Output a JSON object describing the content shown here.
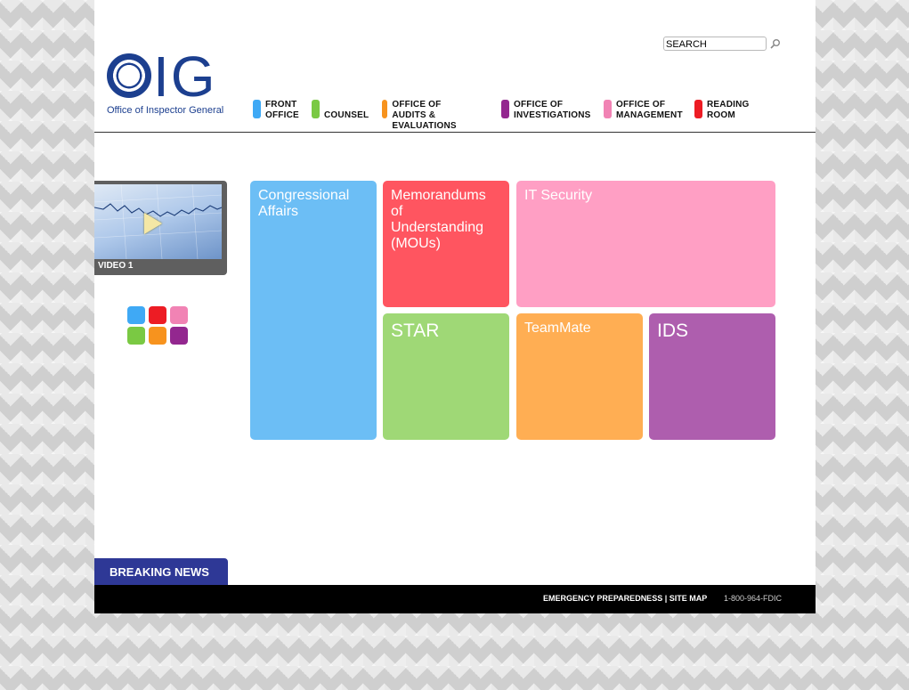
{
  "header": {
    "logo_text": "IG",
    "logo_subtitle": "Office of Inspector General",
    "search_value": "SEARCH"
  },
  "nav": [
    {
      "label": "FRONT\nOFFICE",
      "color": "#3fa9f5"
    },
    {
      "label": "\nCOUNSEL",
      "color": "#7ac943"
    },
    {
      "label": "OFFICE OF AUDITS &\nEVALUATIONS",
      "color": "#f7931e"
    },
    {
      "label": "OFFICE OF\nINVESTIGATIONS",
      "color": "#93278f"
    },
    {
      "label": "OFFICE OF\nMANAGEMENT",
      "color": "#f183b4"
    },
    {
      "label": "READING\nROOM",
      "color": "#ed1c24"
    }
  ],
  "video": {
    "label": "VIDEO 1"
  },
  "swatches": [
    "#3fa9f5",
    "#ed1c24",
    "#f183b4",
    "#7ac943",
    "#f7931e",
    "#93278f"
  ],
  "tiles": [
    {
      "label": "Congressional\nAffairs",
      "color": "#6cbef5"
    },
    {
      "label": "Memorandums of\nUnderstanding\n(MOUs)",
      "color": "#ff5560"
    },
    {
      "label": "IT Security",
      "color": "#ff9fc4"
    },
    {
      "label": "STAR",
      "color": "#9fd876"
    },
    {
      "label": "TeamMate",
      "color": "#ffae53"
    },
    {
      "label": "IDS",
      "color": "#ae5eae"
    }
  ],
  "breaking_news": "BREAKING NEWS",
  "footer": {
    "emergency": "EMERGENCY PREPAREDNESS",
    "separator": " | ",
    "sitemap": "SITE MAP",
    "phone": "1-800-964-FDIC"
  }
}
